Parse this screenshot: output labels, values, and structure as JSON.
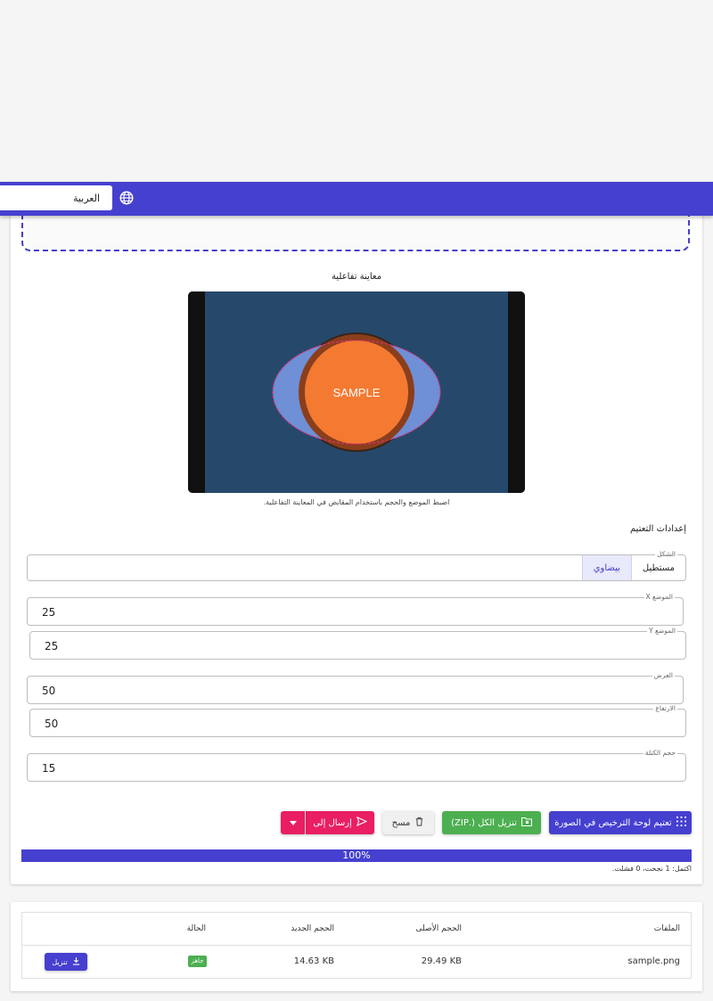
{
  "header": {
    "language": "العربية"
  },
  "preview": {
    "title": "معاينة تفاعلية",
    "sample_text": "SAMPLE",
    "hint": "اضبط الموضع والحجم باستخدام المقابض في المعاينة التفاعلية."
  },
  "settings": {
    "title": "إعدادات التعتيم",
    "shape_label": "الشكل",
    "shape_options": [
      "مستطيل",
      "بيضاوي"
    ],
    "shape_selected": "بيضاوي",
    "x_label": "الموضع X",
    "x_value": "25",
    "y_label": "الموضع Y",
    "y_value": "25",
    "width_label": "العرض",
    "width_value": "50",
    "height_label": "الارتفاع",
    "height_value": "50",
    "block_label": "حجم الكتلة",
    "block_value": "15"
  },
  "actions": {
    "pixelate_label": "تعتيم لوحة الترخيص في الصورة",
    "download_all_label": "تنزيل الكل (.ZIP)",
    "clear_label": "مسح",
    "send_label": "إرسال إلى"
  },
  "progress": {
    "percent": 100,
    "text": "100%",
    "summary": "اكتمل: 1 نجحت، 0 فشلت."
  },
  "table": {
    "headers": {
      "files": "الملفات",
      "original": "الحجم الأصلى",
      "new": "الحجم الجديد",
      "status": "الحالة"
    },
    "rows": [
      {
        "file": "sample.png",
        "original": "29.49 KB",
        "new": "14.63 KB",
        "status": "جاهز",
        "action": "تنزيل"
      }
    ]
  },
  "colors": {
    "primary": "#4540cf",
    "success": "#4caf50",
    "accent": "#e91e63",
    "sample_orange": "#f47a32"
  }
}
